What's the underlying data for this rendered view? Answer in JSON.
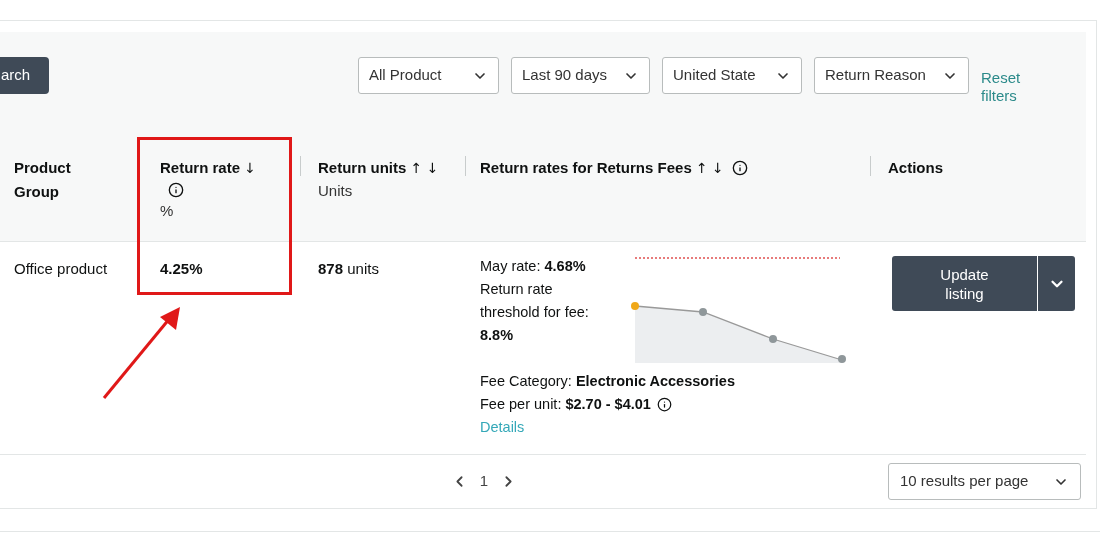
{
  "search_button": "arch",
  "filters": [
    {
      "value": "All Product"
    },
    {
      "value": "Last 90 days"
    },
    {
      "value": "United State"
    },
    {
      "value": "Return Reason"
    }
  ],
  "reset_link": "Reset filters",
  "columns": [
    {
      "title": "Product Group"
    },
    {
      "title": "Return rate",
      "sort_arrows": "↓",
      "info": true,
      "unit": "%"
    },
    {
      "title": "Return units",
      "sort_arrows": "↑ ↓",
      "unit": "Units"
    },
    {
      "title": "Return rates for Returns Fees",
      "sort_arrows": "↑ ↓",
      "info": true
    },
    {
      "title": "Actions"
    }
  ],
  "row": {
    "product_group": "Office product",
    "return_rate": "4.25%",
    "return_units": "**878** units",
    "fees": {
      "may_rate": "May rate: **4.68%**",
      "threshold": "Return rate threshold for fee: **8.8%**",
      "fee_category": "Fee Category: **Electronic Accessories**",
      "fee_per_unit": "Fee per unit: **$2.70 - $4.01**",
      "details_link": "Details"
    },
    "action": "Update listing"
  },
  "pagination": {
    "page": "1"
  },
  "per_page": "10 results per page"
}
